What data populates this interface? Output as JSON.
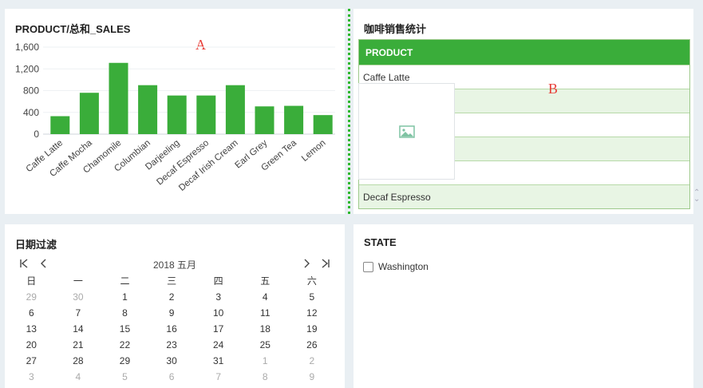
{
  "chart_panel": {
    "title": "PRODUCT/总和_SALES",
    "marker": "A"
  },
  "chart_data": {
    "type": "bar",
    "title": "PRODUCT/总和_SALES",
    "categories": [
      "Caffe Latte",
      "Caffe Mocha",
      "Chamomile",
      "Columbian",
      "Darjeeling",
      "Decaf Espresso",
      "Decaf Irish Cream",
      "Earl Grey",
      "Green Tea",
      "Lemon"
    ],
    "values": [
      330,
      760,
      1310,
      900,
      710,
      710,
      900,
      510,
      520,
      350
    ],
    "yticks": [
      "0",
      "400",
      "800",
      "1,200",
      "1,600"
    ],
    "ylim": [
      0,
      1600
    ],
    "color": "#3aad3a",
    "grid": true
  },
  "table_panel": {
    "title": "咖啡销售统计",
    "marker": "B",
    "header": "PRODUCT",
    "rows": [
      "Caffe Latte",
      "",
      "",
      "",
      "",
      "Decaf Espresso"
    ],
    "image_placeholder_icon": "image-icon",
    "scroll_icon": "scroll-arrows-icon"
  },
  "date_panel": {
    "title": "日期过滤",
    "month_label": "2018 五月",
    "weekdays": [
      "日",
      "一",
      "二",
      "三",
      "四",
      "五",
      "六"
    ],
    "weeks": [
      [
        "29",
        "30",
        "1",
        "2",
        "3",
        "4",
        "5"
      ],
      [
        "6",
        "7",
        "8",
        "9",
        "10",
        "11",
        "12"
      ],
      [
        "13",
        "14",
        "15",
        "16",
        "17",
        "18",
        "19"
      ],
      [
        "20",
        "21",
        "22",
        "23",
        "24",
        "25",
        "26"
      ],
      [
        "27",
        "28",
        "29",
        "30",
        "31",
        "1",
        "2"
      ],
      [
        "3",
        "4",
        "5",
        "6",
        "7",
        "8",
        "9"
      ]
    ],
    "nav": {
      "first": "|<",
      "prev": "<",
      "next": ">",
      "last": ">|"
    }
  },
  "state_panel": {
    "title": "STATE",
    "options": [
      {
        "label": "Washington",
        "checked": false
      }
    ]
  }
}
